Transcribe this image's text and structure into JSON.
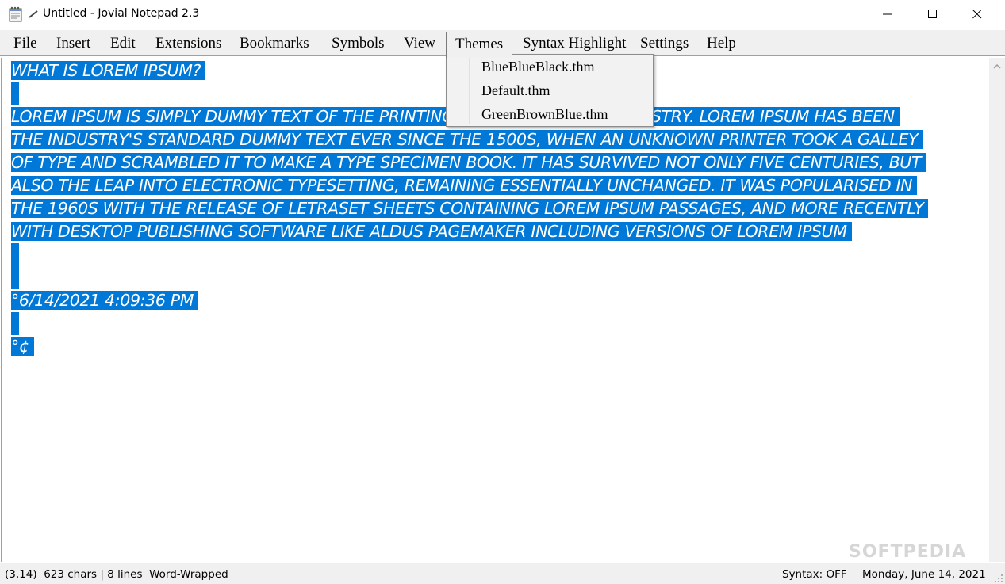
{
  "window": {
    "title": "Untitled - Jovial Notepad 2.3",
    "icon": "notepad-icon"
  },
  "menu": {
    "items": [
      {
        "label": "File"
      },
      {
        "label": "Insert"
      },
      {
        "label": "Edit"
      },
      {
        "label": "Extensions"
      },
      {
        "label": "Bookmarks"
      },
      {
        "label": "Symbols"
      },
      {
        "label": "View"
      },
      {
        "label": "Themes"
      },
      {
        "label": "Syntax Highlight"
      },
      {
        "label": "Settings"
      },
      {
        "label": "Help"
      }
    ],
    "active": "Themes"
  },
  "themes_menu": {
    "items": [
      {
        "label": "BlueBlueBlack.thm"
      },
      {
        "label": "Default.thm"
      },
      {
        "label": "GreenBrownBlue.thm"
      }
    ]
  },
  "editor": {
    "lines": [
      "WHAT IS LOREM IPSUM? ",
      "",
      "LOREM IPSUM IS SIMPLY DUMMY TEXT OF THE PRINTING AND TYPESETTING INDUSTRY. LOREM IPSUM HAS BEEN",
      "THE INDUSTRY'S STANDARD DUMMY TEXT EVER SINCE THE 1500S, WHEN AN UNKNOWN PRINTER TOOK A GALLEY",
      "OF TYPE AND SCRAMBLED IT TO MAKE A TYPE SPECIMEN BOOK. IT HAS SURVIVED NOT ONLY FIVE CENTURIES, BUT",
      "ALSO THE LEAP INTO ELECTRONIC TYPESETTING, REMAINING ESSENTIALLY UNCHANGED. IT WAS POPULARISED IN",
      "THE 1960S WITH THE RELEASE OF LETRASET SHEETS CONTAINING LOREM IPSUM PASSAGES, AND MORE RECENTLY",
      "WITH DESKTOP PUBLISHING SOFTWARE LIKE ALDUS PAGEMAKER INCLUDING VERSIONS OF LOREM IPSUM ",
      "",
      "",
      "°6/14/2021 4:09:36 PM ",
      "",
      "°¢"
    ],
    "selection_color": "#0078d7",
    "text_color": "#ffffff"
  },
  "status": {
    "position": "(3,14)",
    "chars": "623 chars | 8 lines",
    "wrap": "Word-Wrapped",
    "syntax": "Syntax: OFF",
    "date": "Monday, June 14, 2021"
  },
  "watermark": "SOFTPEDIA"
}
